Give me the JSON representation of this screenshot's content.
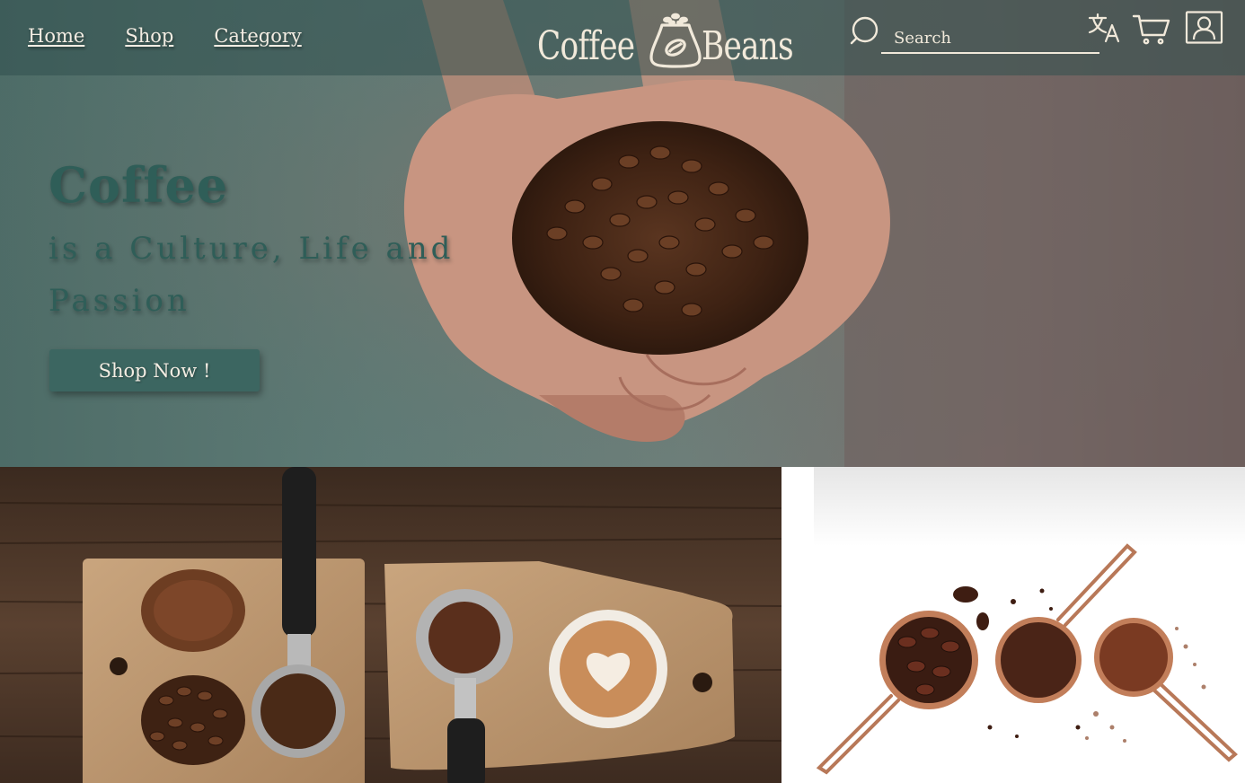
{
  "header": {
    "nav": [
      {
        "label": "Home"
      },
      {
        "label": "Shop"
      },
      {
        "label": "Category"
      }
    ],
    "logo": {
      "word1": "Coffee",
      "word2": "Beans"
    },
    "search": {
      "placeholder": "Search",
      "value": ""
    },
    "icons": [
      "search-icon",
      "translate-icon",
      "cart-icon",
      "user-icon"
    ]
  },
  "hero": {
    "headline": "Coffee",
    "tagline": "is a Culture, Life and Passion",
    "cta_label": "Shop Now !"
  },
  "gallery": [
    {
      "name": "espresso-tools-photo"
    },
    {
      "name": "measuring-cups-photo"
    }
  ],
  "colors": {
    "header_overlay": "#32504e",
    "accent_teal": "#2f5e58",
    "button": "#3c6661",
    "light_text": "#f1e9da"
  }
}
